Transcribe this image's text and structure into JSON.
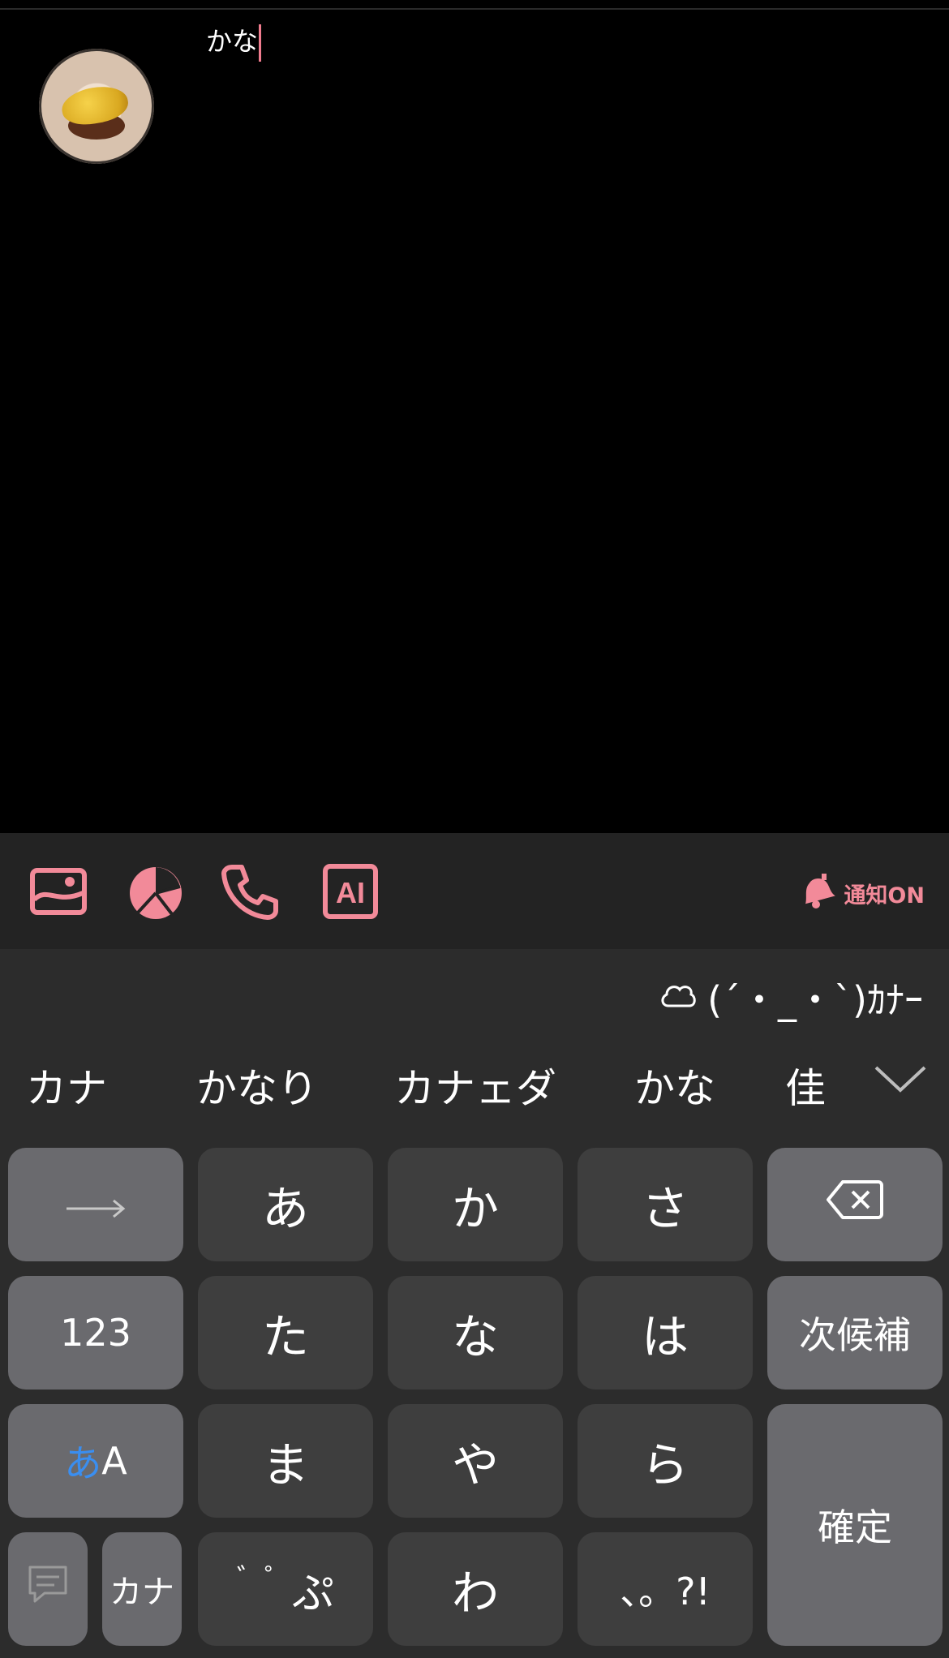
{
  "post": {
    "input_text": "かな"
  },
  "toolbar": {
    "icons": [
      "image-icon",
      "pie-chart-icon",
      "phone-icon",
      "ai-icon"
    ],
    "notify_label": "通知ON",
    "accent_color": "#f28a99"
  },
  "keyboard": {
    "top_suggestion": "(´・_・`)ｶﾅｰ",
    "candidates": [
      "カナ",
      "かなり",
      "カナェダ",
      "かな",
      "佳"
    ],
    "keys": {
      "arrow": "→",
      "a": "あ",
      "ka": "か",
      "sa": "さ",
      "num": "123",
      "ta": "た",
      "na": "な",
      "ha": "は",
      "next_candidate": "次候補",
      "mode_a": "あ",
      "mode_A": "A",
      "ma": "ま",
      "ya": "や",
      "ra": "ら",
      "confirm": "確定",
      "kana": "カナ",
      "dakuten": "゛゜",
      "dakuten_small": "ぷ",
      "wa": "わ",
      "punct": "、。?!"
    }
  }
}
